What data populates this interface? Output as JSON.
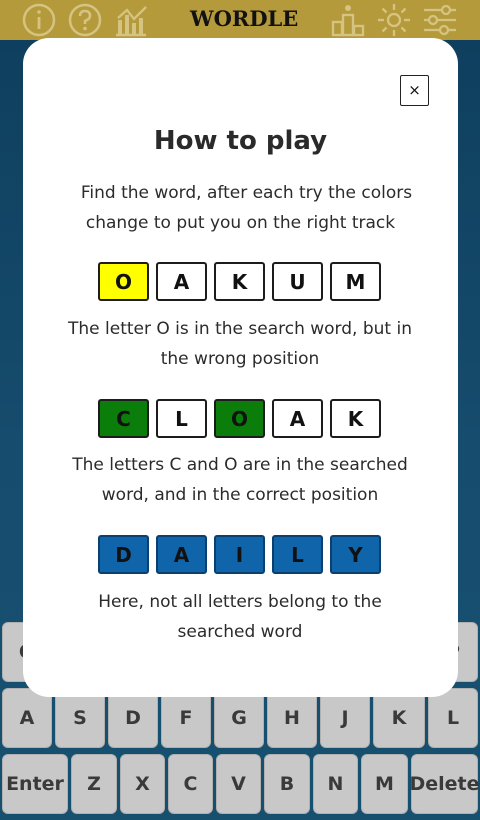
{
  "header": {
    "logo": "WORDLE",
    "icons": [
      "info-icon",
      "help-icon",
      "stats-icon",
      "leaderboard-icon",
      "brightness-icon",
      "settings-icon"
    ],
    "bar_color": "#b59a3c"
  },
  "keyboard": {
    "row1": [
      "Q",
      "P"
    ],
    "row2": [
      "A",
      "S",
      "D",
      "F",
      "G",
      "H",
      "J",
      "K",
      "L"
    ],
    "row3": [
      "Enter",
      "Z",
      "X",
      "C",
      "V",
      "B",
      "N",
      "M",
      "Delete"
    ]
  },
  "modal": {
    "close": "×",
    "title": "How to play",
    "intro": "Find the word, after each try the colors change to put you on the right track",
    "examples": [
      {
        "letters": [
          "O",
          "A",
          "K",
          "U",
          "M"
        ],
        "states": [
          "present",
          "none",
          "none",
          "none",
          "none"
        ],
        "description": "The letter O is in the search word, but in the wrong position"
      },
      {
        "letters": [
          "C",
          "L",
          "O",
          "A",
          "K"
        ],
        "states": [
          "correct",
          "none",
          "correct",
          "none",
          "none"
        ],
        "description": "The letters C and O are in the searched word, and in the correct position"
      },
      {
        "letters": [
          "D",
          "A",
          "I",
          "L",
          "Y"
        ],
        "states": [
          "absent",
          "absent",
          "absent",
          "absent",
          "absent"
        ],
        "description": "Here, not all letters belong to the searched word"
      }
    ]
  },
  "colors": {
    "present": "#ffff00",
    "correct": "#0a7d0a",
    "absent": "#0f64aa",
    "none": "#ffffff"
  }
}
